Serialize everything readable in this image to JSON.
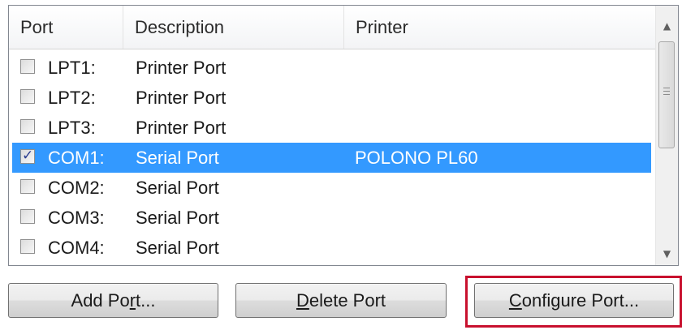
{
  "columns": [
    "Port",
    "Description",
    "Printer"
  ],
  "rows": [
    {
      "port": "LPT1:",
      "description": "Printer Port",
      "printer": "",
      "checked": false,
      "selected": false
    },
    {
      "port": "LPT2:",
      "description": "Printer Port",
      "printer": "",
      "checked": false,
      "selected": false
    },
    {
      "port": "LPT3:",
      "description": "Printer Port",
      "printer": "",
      "checked": false,
      "selected": false
    },
    {
      "port": "COM1:",
      "description": "Serial Port",
      "printer": "POLONO PL60",
      "checked": true,
      "selected": true
    },
    {
      "port": "COM2:",
      "description": "Serial Port",
      "printer": "",
      "checked": false,
      "selected": false
    },
    {
      "port": "COM3:",
      "description": "Serial Port",
      "printer": "",
      "checked": false,
      "selected": false
    },
    {
      "port": "COM4:",
      "description": "Serial Port",
      "printer": "",
      "checked": false,
      "selected": false
    }
  ],
  "buttons": {
    "add_port": {
      "before": "Add Po",
      "mnemonic": "r",
      "after": "t..."
    },
    "delete_port": {
      "before": "",
      "mnemonic": "D",
      "after": "elete Port"
    },
    "configure_port": {
      "before": "",
      "mnemonic": "C",
      "after": "onfigure Port..."
    }
  },
  "icons": {
    "scroll_up": "chevron-up-icon",
    "scroll_down": "chevron-down-icon",
    "check": "checkmark-icon"
  },
  "colors": {
    "selection": "#3399ff",
    "highlight_box": "#c8102e"
  }
}
